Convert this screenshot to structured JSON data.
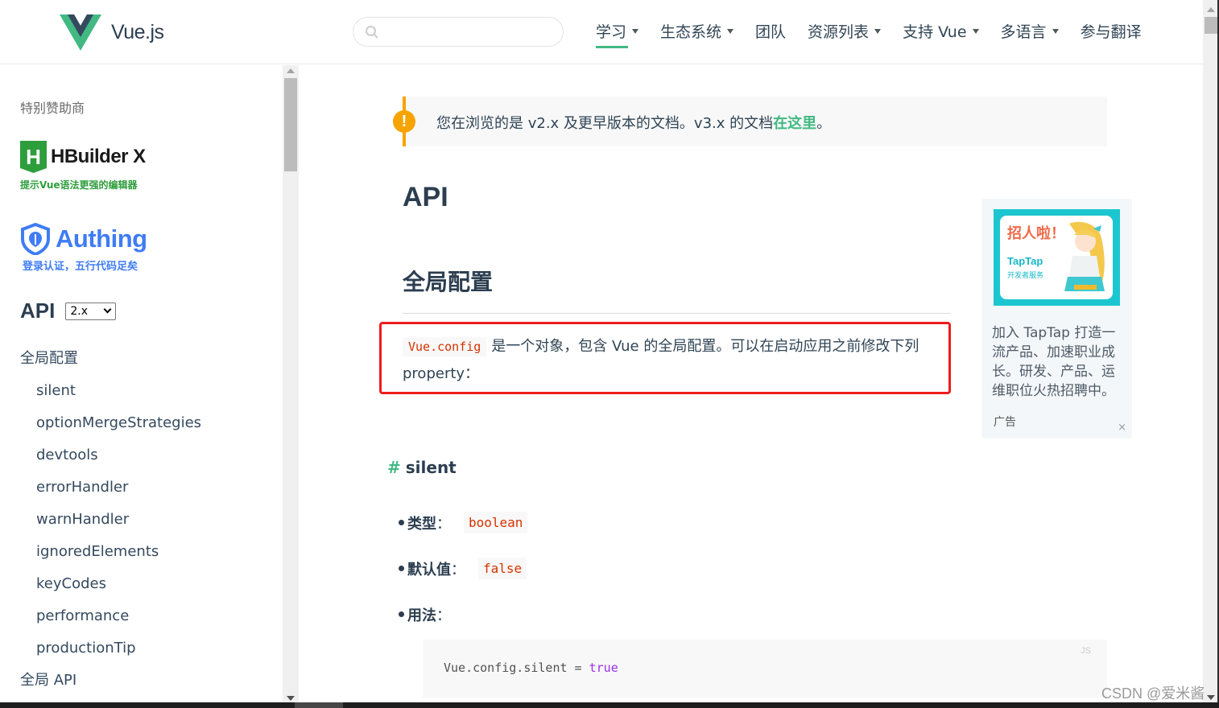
{
  "header": {
    "brand": "Vue.js",
    "search": {
      "value": "",
      "placeholder": ""
    },
    "nav": [
      {
        "label": "学习",
        "dropdown": true,
        "active": true
      },
      {
        "label": "生态系统",
        "dropdown": true
      },
      {
        "label": "团队",
        "dropdown": false
      },
      {
        "label": "资源列表",
        "dropdown": true
      },
      {
        "label": "支持 Vue",
        "dropdown": true
      },
      {
        "label": "多语言",
        "dropdown": true
      },
      {
        "label": "参与翻译",
        "dropdown": false
      }
    ]
  },
  "sidebar": {
    "sponsor_title": "特别赞助商",
    "sponsors": [
      {
        "name": "HBuilder X",
        "mark": "H",
        "tagline": "提示Vue语法更强的编辑器"
      },
      {
        "name": "Authing",
        "tagline": "登录认证，五行代码足矣"
      }
    ],
    "api_title": "API",
    "version": "2.x",
    "menu": [
      {
        "label": "全局配置",
        "level": 1
      },
      {
        "label": "silent",
        "level": 2
      },
      {
        "label": "optionMergeStrategies",
        "level": 2
      },
      {
        "label": "devtools",
        "level": 2
      },
      {
        "label": "errorHandler",
        "level": 2
      },
      {
        "label": "warnHandler",
        "level": 2
      },
      {
        "label": "ignoredElements",
        "level": 2
      },
      {
        "label": "keyCodes",
        "level": 2
      },
      {
        "label": "performance",
        "level": 2
      },
      {
        "label": "productionTip",
        "level": 2
      },
      {
        "label": "全局 API",
        "level": 1
      }
    ]
  },
  "content": {
    "notice": {
      "icon": "!",
      "text": "您在浏览的是 v2.x 及更早版本的文档。v3.x 的文档",
      "link": "在这里",
      "suffix": "。"
    },
    "title": "API",
    "section_title": "全局配置",
    "intro": {
      "code": "Vue.config",
      "text": "是一个对象，包含 Vue 的全局配置。可以在启动应用之前修改下列 property："
    },
    "subsection": {
      "hash": "#",
      "title": "silent",
      "items": [
        {
          "label": "类型",
          "colon": "：",
          "code": "boolean"
        },
        {
          "label": "默认值",
          "colon": "：",
          "code": "false"
        },
        {
          "label": "用法",
          "colon": "：",
          "code": ""
        }
      ],
      "code_block": {
        "lang": "JS",
        "code_prefix": "Vue.config.silent = ",
        "code_keyword": "true"
      }
    }
  },
  "ad": {
    "image_headline": "招人啦！",
    "image_brand": "TapTap",
    "image_sub": "开发者服务",
    "text": "加入 TapTap 打造一流产品、加速职业成长。研发、产品、运维职位火热招聘中。",
    "label": "广告",
    "close": "×"
  },
  "watermark": "CSDN @爱米酱",
  "colors": {
    "accent": "#42b983",
    "warning": "#f7a300",
    "highlight_border": "#ee1c1c",
    "code_text": "#d63200"
  }
}
